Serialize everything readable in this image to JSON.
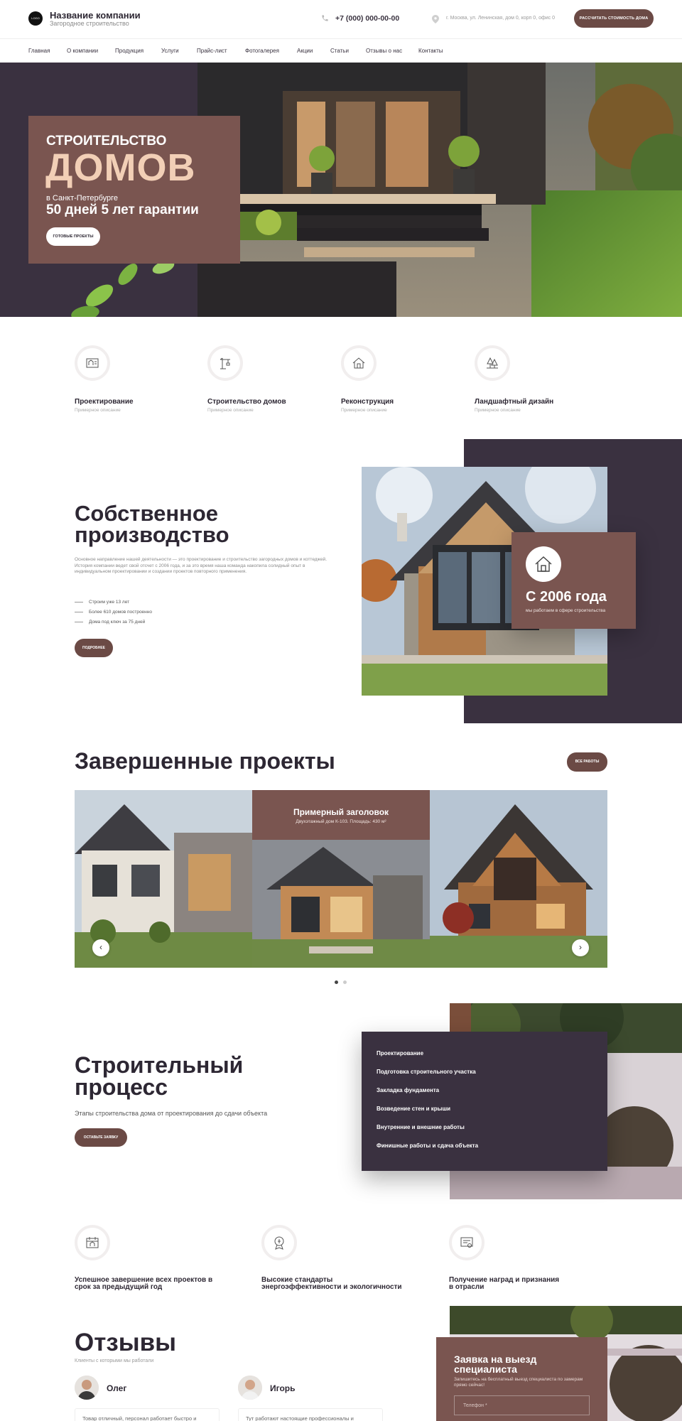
{
  "header": {
    "logo_text": "LOGO",
    "company_name": "Название компании",
    "company_tagline": "Загородное строительство",
    "phone": "+7 (000) 000-00-00",
    "address": "г. Москва, ул. Ленинская, дом 0, корп 0, офис 0",
    "cta": "РАССЧИТАТЬ СТОИМОСТЬ ДОМА"
  },
  "nav": [
    "Главная",
    "О компании",
    "Продукция",
    "Услуги",
    "Прайс-лист",
    "Фотогалерея",
    "Акции",
    "Статьи",
    "Отзывы о нас",
    "Контакты"
  ],
  "hero": {
    "line1": "СТРОИТЕЛЬСТВО",
    "line2": "ДОМОВ",
    "line3": "в Санкт-Петербурге",
    "line4": "50 дней 5 лет гарантии",
    "button": "ГОТОВЫЕ ПРОЕКТЫ"
  },
  "services": [
    {
      "title": "Проектирование",
      "sub": "Примерное описание",
      "icon": "blueprint-icon"
    },
    {
      "title": "Строительство домов",
      "sub": "Примерное описание",
      "icon": "crane-icon"
    },
    {
      "title": "Реконструкция",
      "sub": "Примерное описание",
      "icon": "house-icon"
    },
    {
      "title": "Ландшафтный дизайн",
      "sub": "Примерное описание",
      "icon": "trees-icon"
    }
  ],
  "production": {
    "title_1": "Собственное",
    "title_2": "производство",
    "text": "Основное направление нашей деятельности — это проектирование и строительство загородных домов и коттеджей. История компании ведет свой отсчет с 2006 года, и за это время наша команда накопила солидный опыт в индивидуальном проектировании и создании проектов повторного применения.",
    "bullets": [
      "Строим уже 13 лет",
      "Более 610 домов  построенно",
      "Дома под ключ за 75 дней"
    ],
    "button": "ПОДРОБНЕЕ",
    "since_title": "С 2006 года",
    "since_sub": "мы работаем в сфере строительства"
  },
  "projects": {
    "title": "Завершенные проекты",
    "button": "ВСЕ РАБОТЫ",
    "featured_title": "Примерный заголовок",
    "featured_sub": "Двухэтажный дом К-103. Площадь: 430 м²",
    "prev": "‹",
    "next": "›"
  },
  "process": {
    "title_1": "Строительный",
    "title_2": "процесс",
    "subtitle": "Этапы строительства дома от проектирования до сдачи объекта",
    "button": "ОСТАВЬТЕ ЗАЯВКУ",
    "steps": [
      "Проектирование",
      "Подготовка строительного участка",
      "Закладка фундамента",
      "Возведение стен и крыши",
      "Внутренние и внешние работы",
      "Финишные работы и сдача объекта"
    ]
  },
  "features": [
    {
      "line1": "Успешное завершение всех проектов в",
      "line2": "срок за предыдущий год",
      "icon": "calendar-house-icon"
    },
    {
      "line1": "Высокие стандарты",
      "line2": "энергоэффективности и экологичности",
      "icon": "eco-badge-icon"
    },
    {
      "line1": "Получение наград и признания",
      "line2": "в отрасли",
      "icon": "certificate-icon"
    }
  ],
  "reviews": {
    "title": "Отзывы",
    "subtitle": "Клиенты с которыми мы работали",
    "items": [
      {
        "name": "Олег",
        "text": "Товар отличный, персонал работает быстро и"
      },
      {
        "name": "Игорь",
        "text": "Тут работают настоящие профессионалы и"
      }
    ]
  },
  "request": {
    "title_1": "Заявка на выезд",
    "title_2": "специалиста",
    "sub": "Запишитесь на бесплатный выезд специалиста по замерам прямо сейчас!",
    "phone_placeholder": "Телефон *"
  },
  "colors": {
    "accent": "#6b4a45",
    "dark": "#3a3140",
    "card": "#7a5550",
    "hero_accent": "#f2cfb6"
  }
}
